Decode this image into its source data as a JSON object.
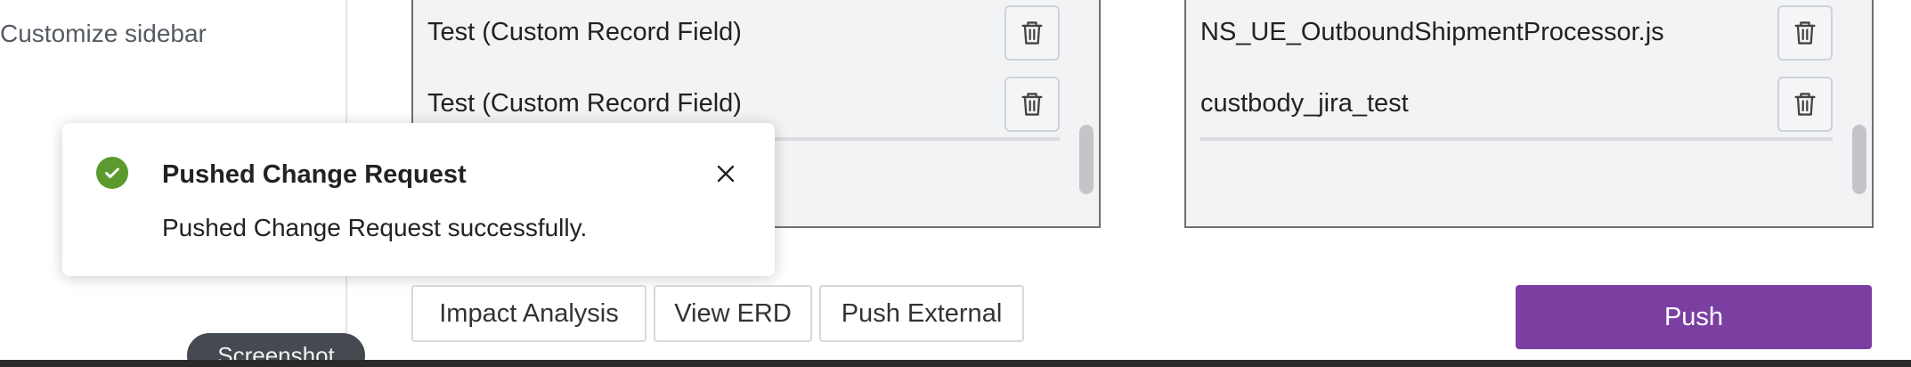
{
  "sidebar": {
    "customize_label": "Customize sidebar"
  },
  "left_panel": {
    "rows": [
      {
        "label": "Test (Custom Record Field)"
      },
      {
        "label": "Test (Custom Record Field)"
      }
    ]
  },
  "right_panel": {
    "rows": [
      {
        "label": "NS_UE_OutboundShipmentProcessor.js"
      },
      {
        "label": "custbody_jira_test"
      }
    ]
  },
  "toast": {
    "title": "Pushed Change Request",
    "message": "Pushed Change Request successfully.",
    "status_color": "#5a9a2e"
  },
  "actions": {
    "impact_label": "Impact Analysis",
    "erd_label": "View ERD",
    "external_label": "Push External",
    "push_label": "Push",
    "push_color": "#7b3fa2"
  },
  "overlay": {
    "screenshot_label": "Screenshot"
  },
  "icons": {
    "delete": "trash-icon",
    "success": "check-circle-icon",
    "dismiss": "close-icon"
  }
}
